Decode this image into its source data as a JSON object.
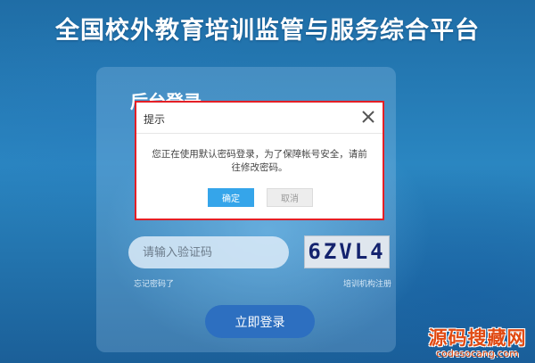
{
  "page": {
    "title": "全国校外教育培训监管与服务综合平台"
  },
  "login": {
    "heading": "后台登录",
    "captcha_placeholder": "请输入验证码",
    "captcha_code": "6ZVL4",
    "forgot_password": "忘记密码了",
    "register_link": "培训机构注册",
    "submit_label": "立即登录"
  },
  "dialog": {
    "title": "提示",
    "message": "您正在使用默认密码登录，为了保障帐号安全，请前往修改密码。",
    "ok_label": "确定",
    "cancel_label": "取消",
    "highlight_color": "#e41f26"
  },
  "watermark": {
    "text": "源码搜藏网",
    "url": "codesocang.com"
  },
  "colors": {
    "background": "#2a86c1",
    "primary_button": "#2d6fc0",
    "ok_button": "#35a5ea"
  }
}
